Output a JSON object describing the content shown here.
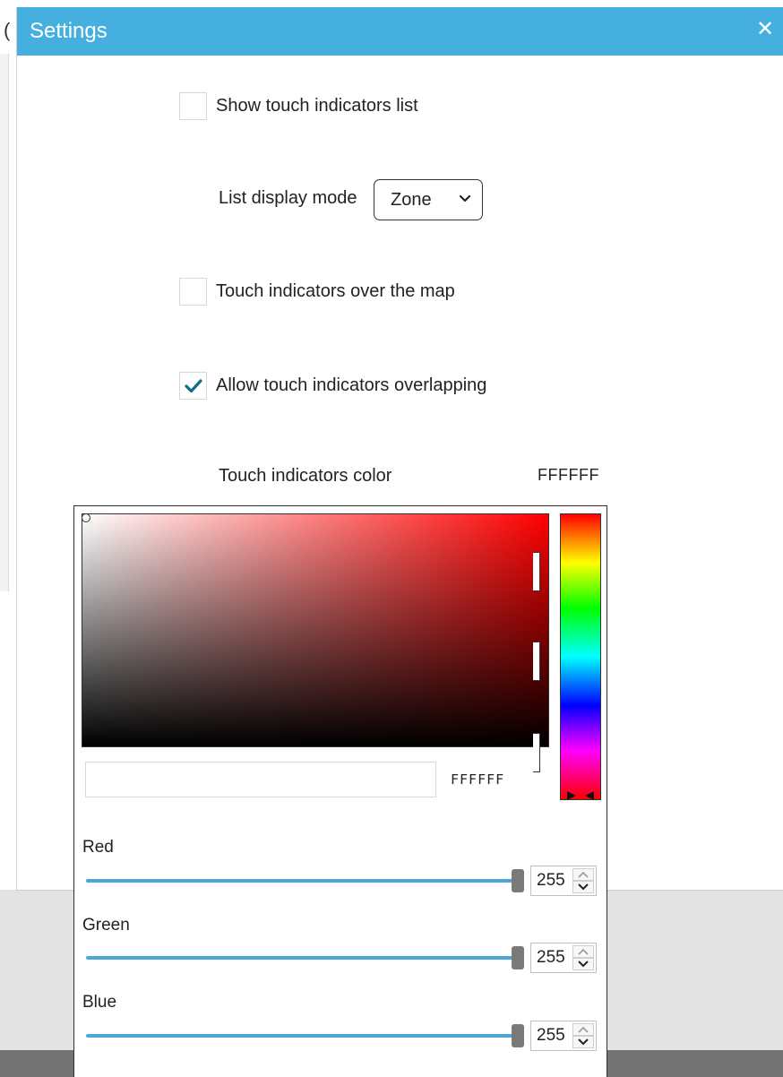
{
  "dialog": {
    "title": "Settings",
    "close_icon": "close-icon"
  },
  "settings": {
    "show_list": {
      "label": "Show touch indicators list",
      "checked": false
    },
    "list_display_mode": {
      "label": "List display mode",
      "value": "Zone"
    },
    "over_map": {
      "label": "Touch indicators over the map",
      "checked": false
    },
    "allow_overlapping": {
      "label": "Allow touch indicators overlapping",
      "checked": true
    },
    "indicator_color": {
      "label": "Touch indicators color",
      "hex": "FFFFFF"
    }
  },
  "color_picker": {
    "hex_input_value": "",
    "hex_readout": "FFFFFF",
    "sliders": [
      {
        "label": "Red",
        "value": "255"
      },
      {
        "label": "Green",
        "value": "255"
      },
      {
        "label": "Blue",
        "value": "255"
      }
    ]
  },
  "colors": {
    "titlebar": "#45b0df",
    "check_accent": "#0e6e8c",
    "slider_track": "#4aa8d8"
  }
}
